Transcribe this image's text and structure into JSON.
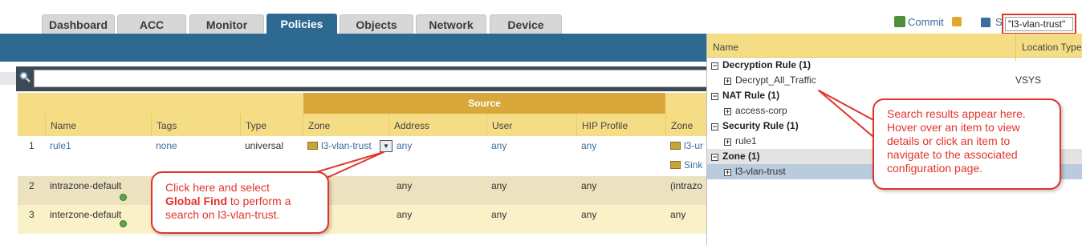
{
  "tabs": [
    "Dashboard",
    "ACC",
    "Monitor",
    "Policies",
    "Objects",
    "Network",
    "Device"
  ],
  "active_tab": "Policies",
  "toolbar": {
    "commit_label": "Commit",
    "save_label": "Sa"
  },
  "global_find": {
    "value": "\"l3-vlan-trust\""
  },
  "table": {
    "group_header": "Source",
    "columns": [
      "Name",
      "Tags",
      "Type",
      "Zone",
      "Address",
      "User",
      "HIP Profile",
      "Zone"
    ],
    "rows": [
      {
        "num": "1",
        "name": "rule1",
        "tags": "none",
        "type": "universal",
        "src_zone": "l3-vlan-trust",
        "address": "any",
        "user": "any",
        "hip": "any",
        "dst_zone": "l3-ur",
        "dst_zone2": "Sink"
      },
      {
        "num": "2",
        "name": "intrazone-default",
        "tags": "",
        "type": "",
        "src_zone": "",
        "address": "any",
        "user": "any",
        "hip": "any",
        "dst_zone": "(intrazo"
      },
      {
        "num": "3",
        "name": "interzone-default",
        "tags": "",
        "type": "",
        "src_zone": "",
        "address": "any",
        "user": "any",
        "hip": "any",
        "dst_zone": "any"
      }
    ]
  },
  "results": {
    "col_name": "Name",
    "col_location": "Location Type",
    "groups": [
      {
        "label": "Decryption Rule (1)",
        "items": [
          {
            "name": "Decrypt_All_Traffic",
            "location": "VSYS"
          }
        ]
      },
      {
        "label": "NAT Rule (1)",
        "items": [
          {
            "name": "access-corp",
            "location": ""
          }
        ]
      },
      {
        "label": "Security Rule (1)",
        "items": [
          {
            "name": "rule1",
            "location": ""
          }
        ]
      },
      {
        "label": "Zone (1)",
        "items": [
          {
            "name": "l3-vlan-trust",
            "location": ""
          }
        ]
      }
    ]
  },
  "callouts": {
    "left": {
      "line1": "Click here and select",
      "bold": "Global Find",
      "line2_rest": " to perform a",
      "line3": "search on l3-vlan-trust."
    },
    "right": {
      "line1": "Search results appear here.",
      "line2": "Hover over an item to view",
      "line3": "details or click an item to",
      "line4": "navigate to the associated",
      "line5": "configuration page."
    }
  },
  "colors": {
    "brand_blue": "#2d6991",
    "header_yellow": "#f5dd85",
    "source_header": "#d9a83a",
    "callout_red": "#e0352b",
    "row_alt": "#ece2c0"
  }
}
